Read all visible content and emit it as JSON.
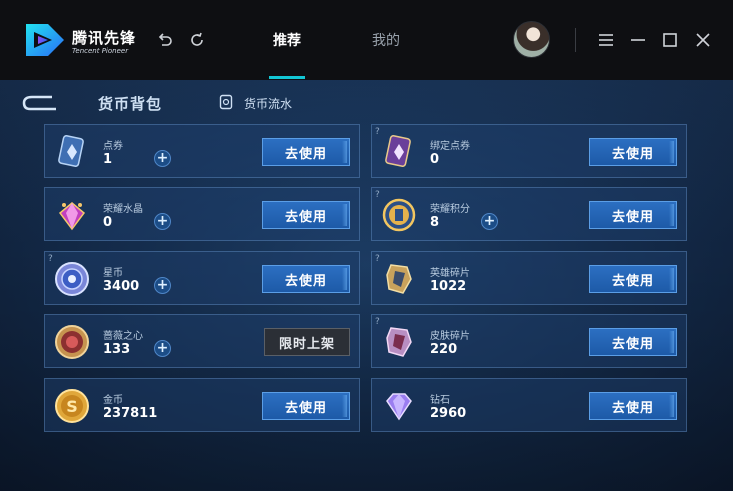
{
  "app": {
    "brand_cn": "腾讯先锋",
    "brand_en": "Tencent Pioneer"
  },
  "nav": {
    "tabs": [
      {
        "label": "推荐",
        "active": true
      },
      {
        "label": "我的",
        "active": false
      }
    ]
  },
  "window_controls": [
    "undo-icon",
    "refresh-icon",
    "menu-icon",
    "minimize-icon",
    "maximize-icon",
    "close-icon"
  ],
  "page": {
    "title": "货币背包",
    "flow_link": "货币流水"
  },
  "currencies": [
    {
      "name": "点券",
      "value": "1",
      "has_plus": true,
      "button": "去使用",
      "icon": "coupon-icon",
      "help": false
    },
    {
      "name": "绑定点券",
      "value": "0",
      "has_plus": false,
      "button": "去使用",
      "icon": "bound-coupon-icon",
      "help": true
    },
    {
      "name": "荣耀水晶",
      "value": "0",
      "has_plus": true,
      "button": "去使用",
      "icon": "crystal-icon",
      "help": false
    },
    {
      "name": "荣耀积分",
      "value": "8",
      "has_plus": true,
      "button": "去使用",
      "icon": "honor-points-icon",
      "help": true
    },
    {
      "name": "星币",
      "value": "3400",
      "has_plus": true,
      "button": "去使用",
      "icon": "star-coin-icon",
      "help": true
    },
    {
      "name": "英雄碎片",
      "value": "1022",
      "has_plus": false,
      "button": "去使用",
      "icon": "hero-fragment-icon",
      "help": true
    },
    {
      "name": "蔷薇之心",
      "value": "133",
      "has_plus": true,
      "button": "限时上架",
      "icon": "rose-heart-icon",
      "help": false
    },
    {
      "name": "皮肤碎片",
      "value": "220",
      "has_plus": false,
      "button": "去使用",
      "icon": "skin-fragment-icon",
      "help": true
    },
    {
      "name": "金币",
      "value": "237811",
      "has_plus": false,
      "button": "去使用",
      "icon": "gold-coin-icon",
      "help": false
    },
    {
      "name": "钻石",
      "value": "2960",
      "has_plus": false,
      "button": "去使用",
      "icon": "diamond-icon",
      "help": false
    }
  ],
  "colors": {
    "accent": "#12c6d4",
    "button": "#2c6fc2",
    "titlebar": "#0e0f12"
  }
}
